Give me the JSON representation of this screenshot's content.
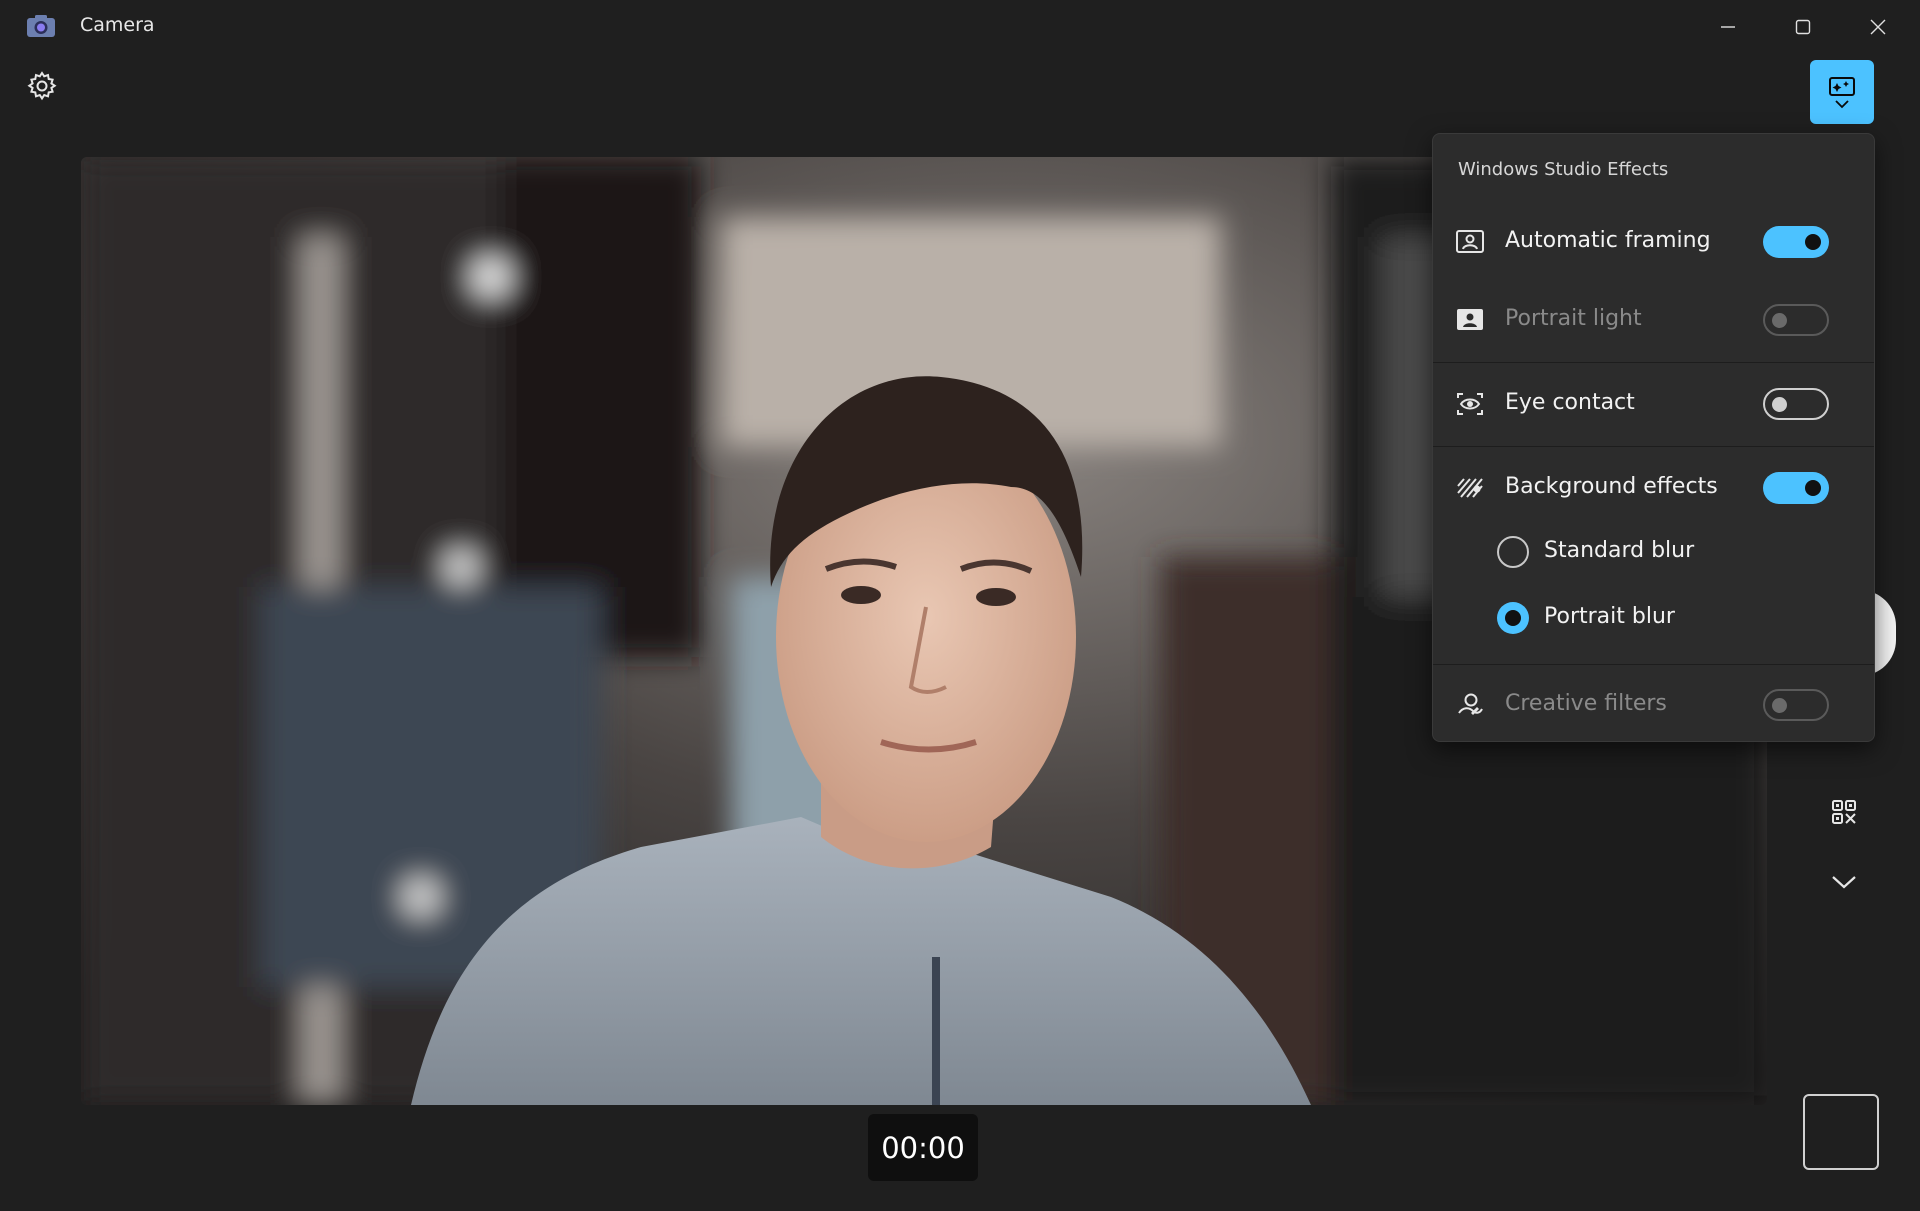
{
  "window": {
    "title": "Camera",
    "controls": [
      "minimize",
      "maximize",
      "close"
    ]
  },
  "toolbar": {
    "settings_icon": "gear-icon",
    "effects_button_icon": "studio-effects-icon"
  },
  "recording": {
    "timer": "00:00"
  },
  "effects_panel": {
    "title": "Windows Studio Effects",
    "items": [
      {
        "label": "Automatic framing",
        "icon": "framing-icon",
        "state": "on",
        "enabled": true
      },
      {
        "label": "Portrait light",
        "icon": "portrait-light-icon",
        "state": "off",
        "enabled": false
      },
      {
        "label": "Eye contact",
        "icon": "eye-contact-icon",
        "state": "off",
        "enabled": true
      },
      {
        "label": "Background effects",
        "icon": "background-effects-icon",
        "state": "on",
        "enabled": true
      },
      {
        "label": "Creative filters",
        "icon": "creative-filters-icon",
        "state": "off",
        "enabled": false
      }
    ],
    "background_options": [
      {
        "label": "Standard blur",
        "selected": false
      },
      {
        "label": "Portrait blur",
        "selected": true
      }
    ]
  },
  "colors": {
    "accent": "#4cc2ff",
    "background": "#1f1f1f",
    "panel": "#2c2c2c"
  }
}
